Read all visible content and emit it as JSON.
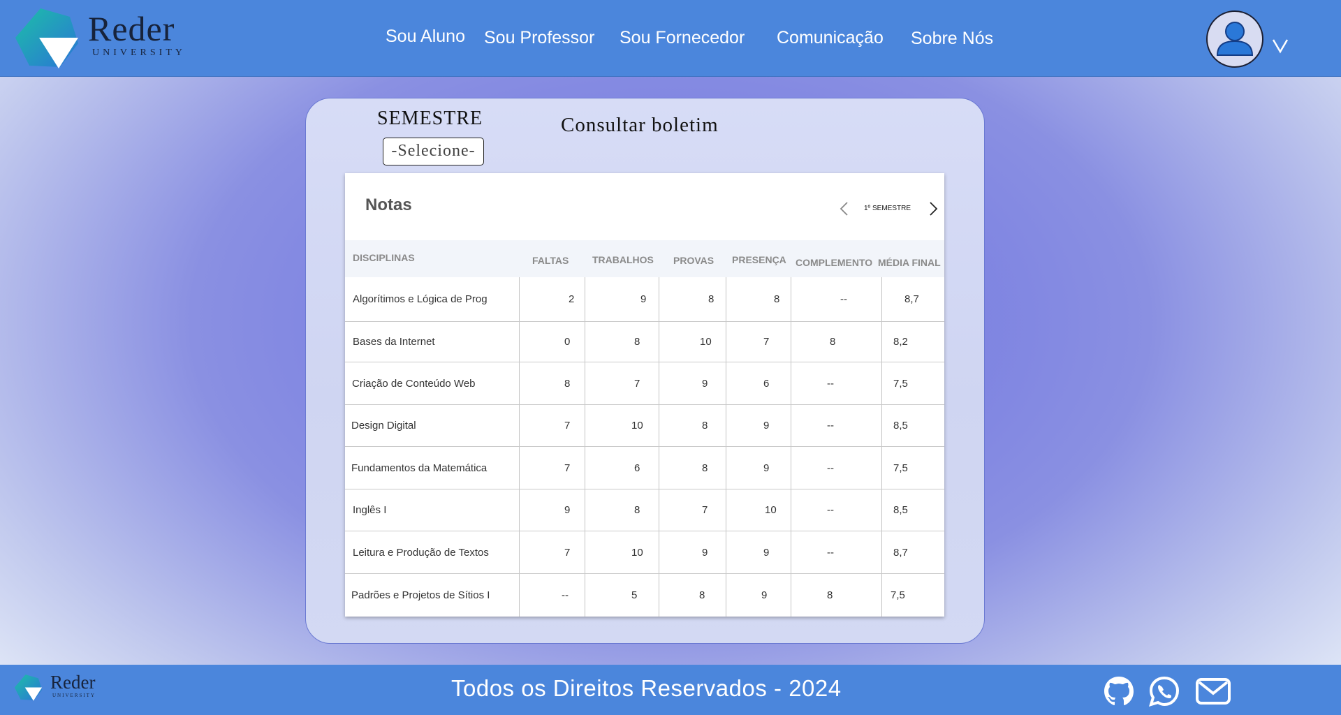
{
  "header": {
    "logo": {
      "name": "Reder",
      "subtitle": "UNIVERSITY"
    },
    "nav": [
      {
        "label": "Sou Aluno"
      },
      {
        "label": "Sou Professor"
      },
      {
        "label": "Sou Fornecedor"
      },
      {
        "label": "Comunicação"
      },
      {
        "label": "Sobre Nós"
      }
    ],
    "user_icon": "user-avatar-icon",
    "menu_icon": "chevron-down-icon"
  },
  "main": {
    "semestre_label": "SEMESTRE",
    "semestre_select": "-Selecione-",
    "title": "Consultar boletim",
    "table": {
      "title": "Notas",
      "current_semester": "1º SEMESTRE",
      "columns": [
        "DISCIPLINAS",
        "FALTAS",
        "TRABALHOS",
        "PROVAS",
        "PRESENÇA",
        "COMPLEMENTO",
        "MÉDIA FINAL"
      ],
      "rows": [
        {
          "disciplina": "Algorítimos e Lógica de Prog",
          "faltas": "2",
          "trabalhos": "9",
          "provas": "8",
          "presenca": "8",
          "complemento": "--",
          "media": "8,7"
        },
        {
          "disciplina": "Bases da Internet",
          "faltas": "0",
          "trabalhos": "8",
          "provas": "10",
          "presenca": "7",
          "complemento": "8",
          "media": "8,2"
        },
        {
          "disciplina": "Criação de Conteúdo Web",
          "faltas": "8",
          "trabalhos": "7",
          "provas": "9",
          "presenca": "6",
          "complemento": "--",
          "media": "7,5"
        },
        {
          "disciplina": "Design Digital",
          "faltas": "7",
          "trabalhos": "10",
          "provas": "8",
          "presenca": "9",
          "complemento": "--",
          "media": "8,5"
        },
        {
          "disciplina": "Fundamentos da Matemática",
          "faltas": "7",
          "trabalhos": "6",
          "provas": "8",
          "presenca": "9",
          "complemento": "--",
          "media": "7,5"
        },
        {
          "disciplina": "Inglês I",
          "faltas": "9",
          "trabalhos": "8",
          "provas": "7",
          "presenca": "10",
          "complemento": "--",
          "media": "8,5"
        },
        {
          "disciplina": "Leitura e Produção de Textos",
          "faltas": "7",
          "trabalhos": "10",
          "provas": "9",
          "presenca": "9",
          "complemento": "--",
          "media": "8,7"
        },
        {
          "disciplina": "Padrões e Projetos de Sítios I",
          "faltas": "--",
          "trabalhos": "5",
          "provas": "8",
          "presenca": "9",
          "complemento": "8",
          "media": "7,5"
        }
      ]
    }
  },
  "footer": {
    "logo": {
      "name": "Reder",
      "subtitle": "UNIVERSITY"
    },
    "text": "Todos os Direitos Reservados - 2024",
    "icons": [
      "github-icon",
      "whatsapp-icon",
      "mail-icon"
    ]
  },
  "colors": {
    "header_bg": "#4b86dc",
    "background_center": "#6b70e0",
    "card_bg": "#d7dcf6",
    "card_border": "#6a79d2"
  }
}
